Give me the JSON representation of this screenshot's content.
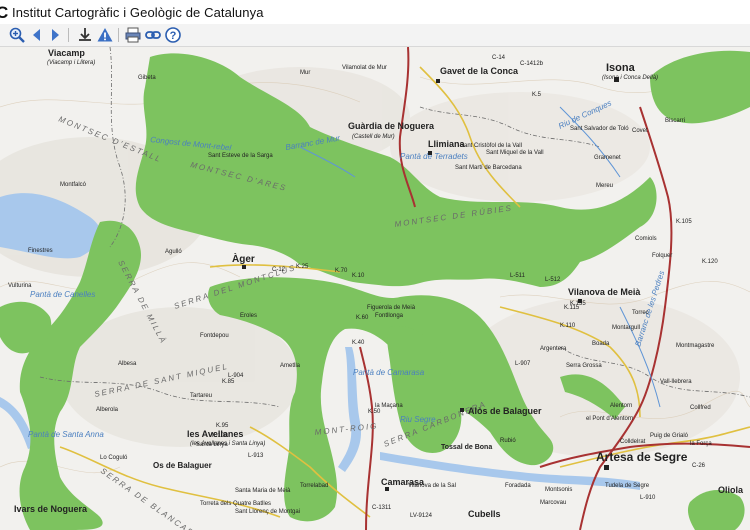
{
  "app": {
    "logo_text": "C",
    "title": "Institut Cartogràfic i Geològic de Catalunya"
  },
  "toolbar": {
    "items": [
      {
        "name": "zoom-in-icon",
        "tooltip": ""
      },
      {
        "name": "back-icon",
        "tooltip": ""
      },
      {
        "name": "forward-icon",
        "tooltip": ""
      },
      {
        "name": "download-icon",
        "tooltip": ""
      },
      {
        "name": "warning-icon",
        "tooltip": ""
      },
      {
        "name": "print-icon",
        "tooltip": ""
      },
      {
        "name": "link-icon",
        "tooltip": ""
      },
      {
        "name": "help-icon",
        "tooltip": ""
      }
    ]
  },
  "colors": {
    "protected_area": "#7dc35f",
    "terrain": "#f2f1ee",
    "water": "#a8c8ec",
    "main_road": "#a83232",
    "secondary_road": "#e0c040",
    "boundary": "#6b6b6b"
  },
  "map": {
    "towns": [
      {
        "id": "viacamp",
        "name": "Viacamp",
        "sub": "(Viacamp i Llitera)"
      },
      {
        "id": "gavet",
        "name": "Gavet de la Conca"
      },
      {
        "id": "isona",
        "name": "Isona",
        "sub": "(Isona i Conca Dellà)"
      },
      {
        "id": "guardia",
        "name": "Guàrdia de Noguera",
        "sub": "(Castell de Mur)"
      },
      {
        "id": "llimiana",
        "name": "Llimiana"
      },
      {
        "id": "ager",
        "name": "Àger"
      },
      {
        "id": "vilanova-meia",
        "name": "Vilanova de Meià"
      },
      {
        "id": "alos",
        "name": "Alòs de Balaguer"
      },
      {
        "id": "avellanes",
        "name": "les Avellanes",
        "sub": "(les Avellanes i Santa Linya)"
      },
      {
        "id": "os-balaguer",
        "name": "Os de Balaguer"
      },
      {
        "id": "artesa",
        "name": "Artesa de Segre"
      },
      {
        "id": "camarasa",
        "name": "Camarasa"
      },
      {
        "id": "cubells",
        "name": "Cubells"
      },
      {
        "id": "ivars",
        "name": "Ivars de Noguera"
      },
      {
        "id": "oliola",
        "name": "Oliola"
      },
      {
        "id": "tossal-bona",
        "name": "Tossal de Bona"
      }
    ],
    "villages": [
      "Gibeta",
      "Mur",
      "Vilamolat de Mur",
      "Sant Esteve de la Sarga",
      "Montfalcó",
      "Finestres",
      "Vulturina",
      "Agulló",
      "Fontdepou",
      "Albesa",
      "Tartareu",
      "Lo Coguló",
      "Santa Maria de Meià",
      "Fontllonga",
      "la Maçana",
      "Figuerola de Meià",
      "Sant Salvador de Toló",
      "Covet",
      "Biscarri",
      "Gramenet",
      "Mereu",
      "Comiols",
      "Folquer",
      "Montargull",
      "Torrec",
      "Boada",
      "Argentera",
      "Vall-llebrera",
      "Alentorn",
      "el Pont d'Alentorn",
      "Collfred",
      "Colldelrat",
      "Puig de Grialó",
      "la Força",
      "Montsonis",
      "Foradada",
      "Marcovau",
      "Tudela de Segre",
      "Torreta dels Quatre Batlles",
      "Sant Miquel de la Vall",
      "Sant Cristòfol de la Vall",
      "Sant Martí de Barcedana",
      "Eroles",
      "Alberola",
      "Torrelabad",
      "Montmagastre",
      "Serra Grossa",
      "Ametlla",
      "Santa Linya",
      "Vilanova de la Sal",
      "Rubió",
      "Sant Llorenç de Montgai"
    ],
    "regions": [
      "MONTSEC D'ESTALL",
      "MONTSEC D'ARES",
      "MONTSEC DE RÚBIES",
      "SERRA DE MILLÀ",
      "SERRA DEL MONTCLÚS",
      "SERRA DE SANT MIQUEL",
      "MONT-ROIG",
      "SERRA CARBONERA",
      "SERRA DE BLANCAFORT",
      "SERRA DEL MONTCLÚS"
    ],
    "water_labels": [
      "Congost de Mont-rebel",
      "Pantà de Terradets",
      "Pantà de Camarasa",
      "Pantà de Canelles",
      "Pantà de Santa Anna",
      "Barranc de Mur",
      "Riu de Conques",
      "Riu Segre",
      "Barranc de les Pedres"
    ],
    "roads": [
      "C-12",
      "C-14",
      "C-1412b",
      "C-26",
      "L-904",
      "L-907",
      "L-913",
      "L-512",
      "L-511",
      "L-910",
      "LV-9124",
      "C-1311",
      "K.5",
      "K.10",
      "K.25",
      "K.40",
      "K.50",
      "K.60",
      "K.70",
      "K.85",
      "K.95",
      "K.100",
      "K.105",
      "K.110",
      "K.115",
      "K.120",
      "K.135"
    ]
  }
}
